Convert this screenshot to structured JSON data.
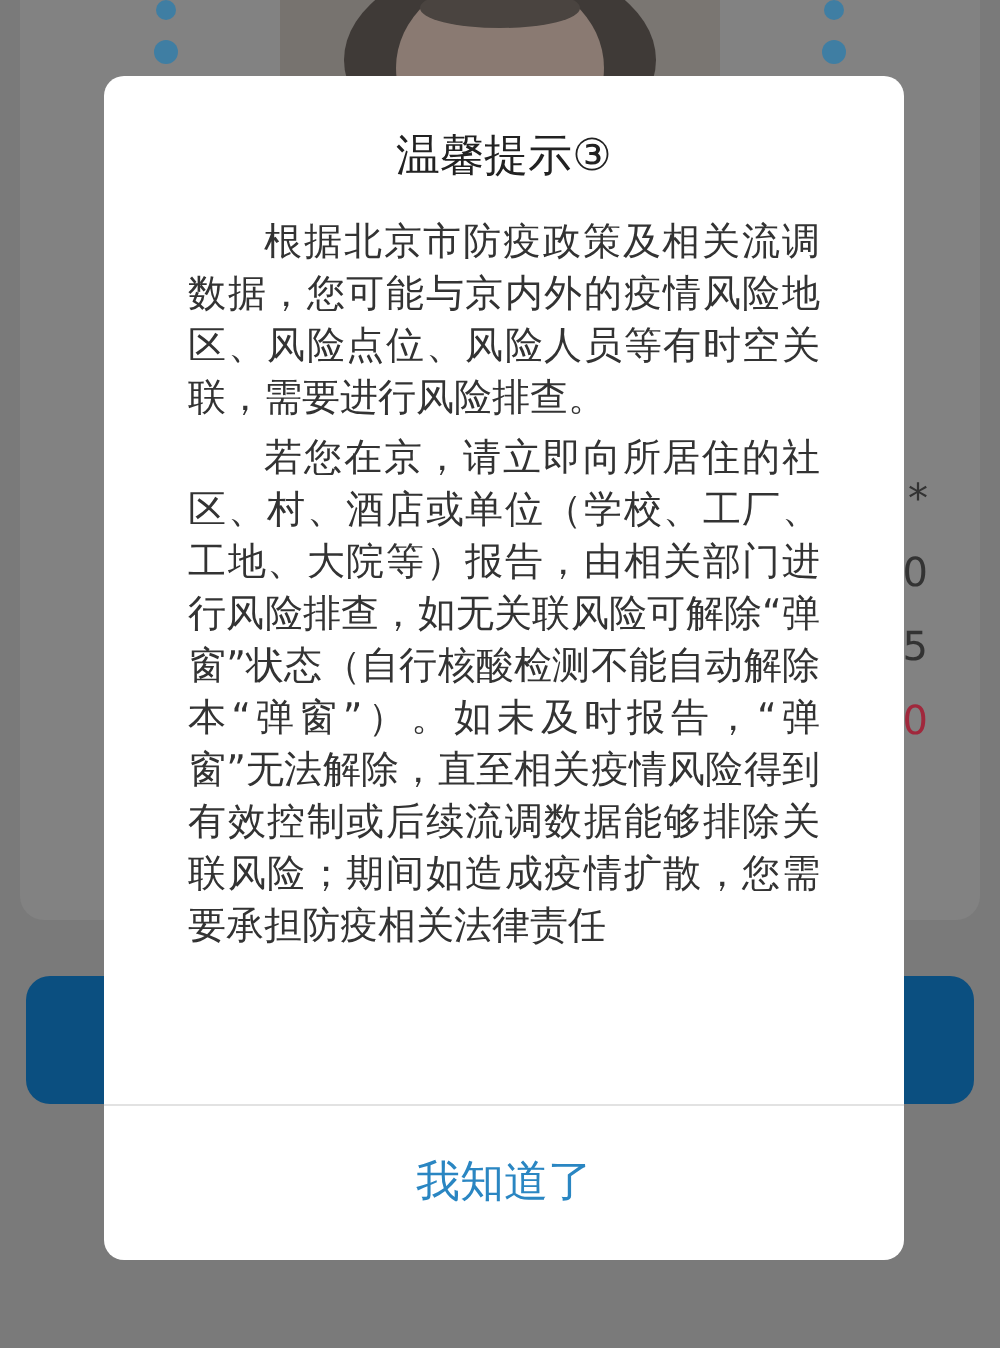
{
  "background": {
    "values": [
      {
        "text": "*",
        "color": "#333333"
      },
      {
        "text": "0",
        "color": "#333333"
      },
      {
        "text": "5",
        "color": "#333333"
      },
      {
        "text": "0",
        "color": "#a0283c"
      }
    ]
  },
  "dialog": {
    "title": "温馨提示③",
    "paragraphs": [
      "根据北京市防疫政策及相关流调数据，您可能与京内外的疫情风险地区、风险点位、风险人员等有时空关联，需要进行风险排查。",
      "若您在京，请立即向所居住的社区、村、酒店或单位（学校、工厂、工地、大院等）报告，由相关部门进行风险排查，如无关联风险可解除“弹窗”状态（自行核酸检测不能自动解除本“弹窗”）。如未及时报告，“弹窗”无法解除，直至相关疫情风险得到有效控制或后续流调数据能够排除关联风险；期间如造成疫情扩散，您需要承担防疫相关法律责任"
    ],
    "button": "我知道了"
  }
}
